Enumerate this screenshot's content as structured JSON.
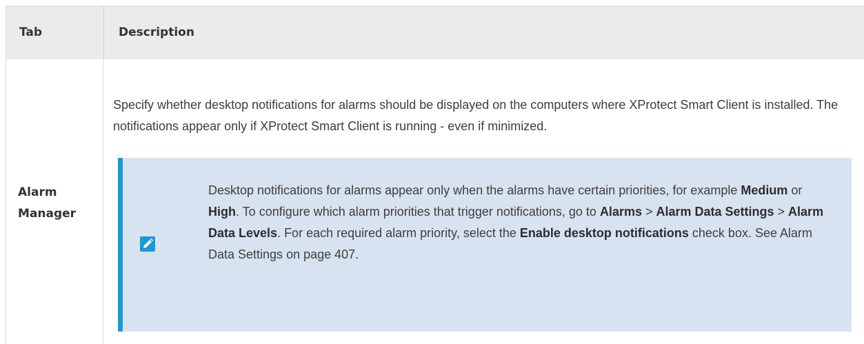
{
  "table": {
    "headers": {
      "tab": "Tab",
      "description": "Description"
    },
    "row": {
      "tab_line1": "Alarm",
      "tab_line2": "Manager",
      "description": "Specify whether desktop notifications for alarms should be displayed on the computers where XProtect Smart Client is installed. The notifications appear only if XProtect Smart Client is running - even if minimized."
    }
  },
  "note": {
    "icon": "pencil-icon",
    "accent_color": "#1b99d6",
    "background_color": "#d8e3f1",
    "segments": {
      "s1": "Desktop notifications for alarms appear only when the alarms have certain priorities, for example ",
      "b1": "Medium",
      "s2": " or ",
      "b2": "High",
      "s3": ". To configure which alarm priorities that trigger notifications, go to ",
      "b3": "Alarms",
      "s4": " > ",
      "b4": "Alarm Data Settings",
      "s5": " > ",
      "b5": "Alarm Data Levels",
      "s6": ". For each required alarm priority, select the ",
      "b6": "Enable desktop notifications",
      "s7": " check box. See Alarm Data Settings on page 407."
    }
  }
}
